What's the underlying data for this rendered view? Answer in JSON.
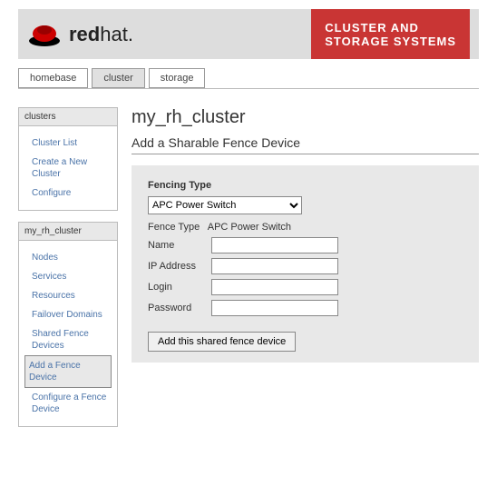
{
  "logo": {
    "brand_before": "red",
    "brand_after": "hat"
  },
  "banner": {
    "line1": "CLUSTER AND",
    "line2": "STORAGE SYSTEMS"
  },
  "tabs": {
    "homebase": "homebase",
    "cluster": "cluster",
    "storage": "storage"
  },
  "sidebar": {
    "clusters_header": "clusters",
    "cluster_list": "Cluster List",
    "create_new": "Create a New Cluster",
    "configure": "Configure",
    "mycluster_header": "my_rh_cluster",
    "nodes": "Nodes",
    "services": "Services",
    "resources": "Resources",
    "failover": "Failover Domains",
    "shared_fence": "Shared Fence Devices",
    "add_fence": "Add a Fence Device",
    "config_fence": "Configure a Fence Device"
  },
  "main": {
    "title": "my_rh_cluster",
    "subtitle": "Add a Sharable Fence Device",
    "fencing_type_label": "Fencing Type",
    "fencing_type_value": "APC Power Switch",
    "fence_type_label": "Fence Type",
    "fence_type_value": "APC Power Switch",
    "name_label": "Name",
    "name_value": "",
    "ip_label": "IP Address",
    "ip_value": "",
    "login_label": "Login",
    "login_value": "",
    "password_label": "Password",
    "password_value": "",
    "submit_label": "Add this shared fence device"
  }
}
